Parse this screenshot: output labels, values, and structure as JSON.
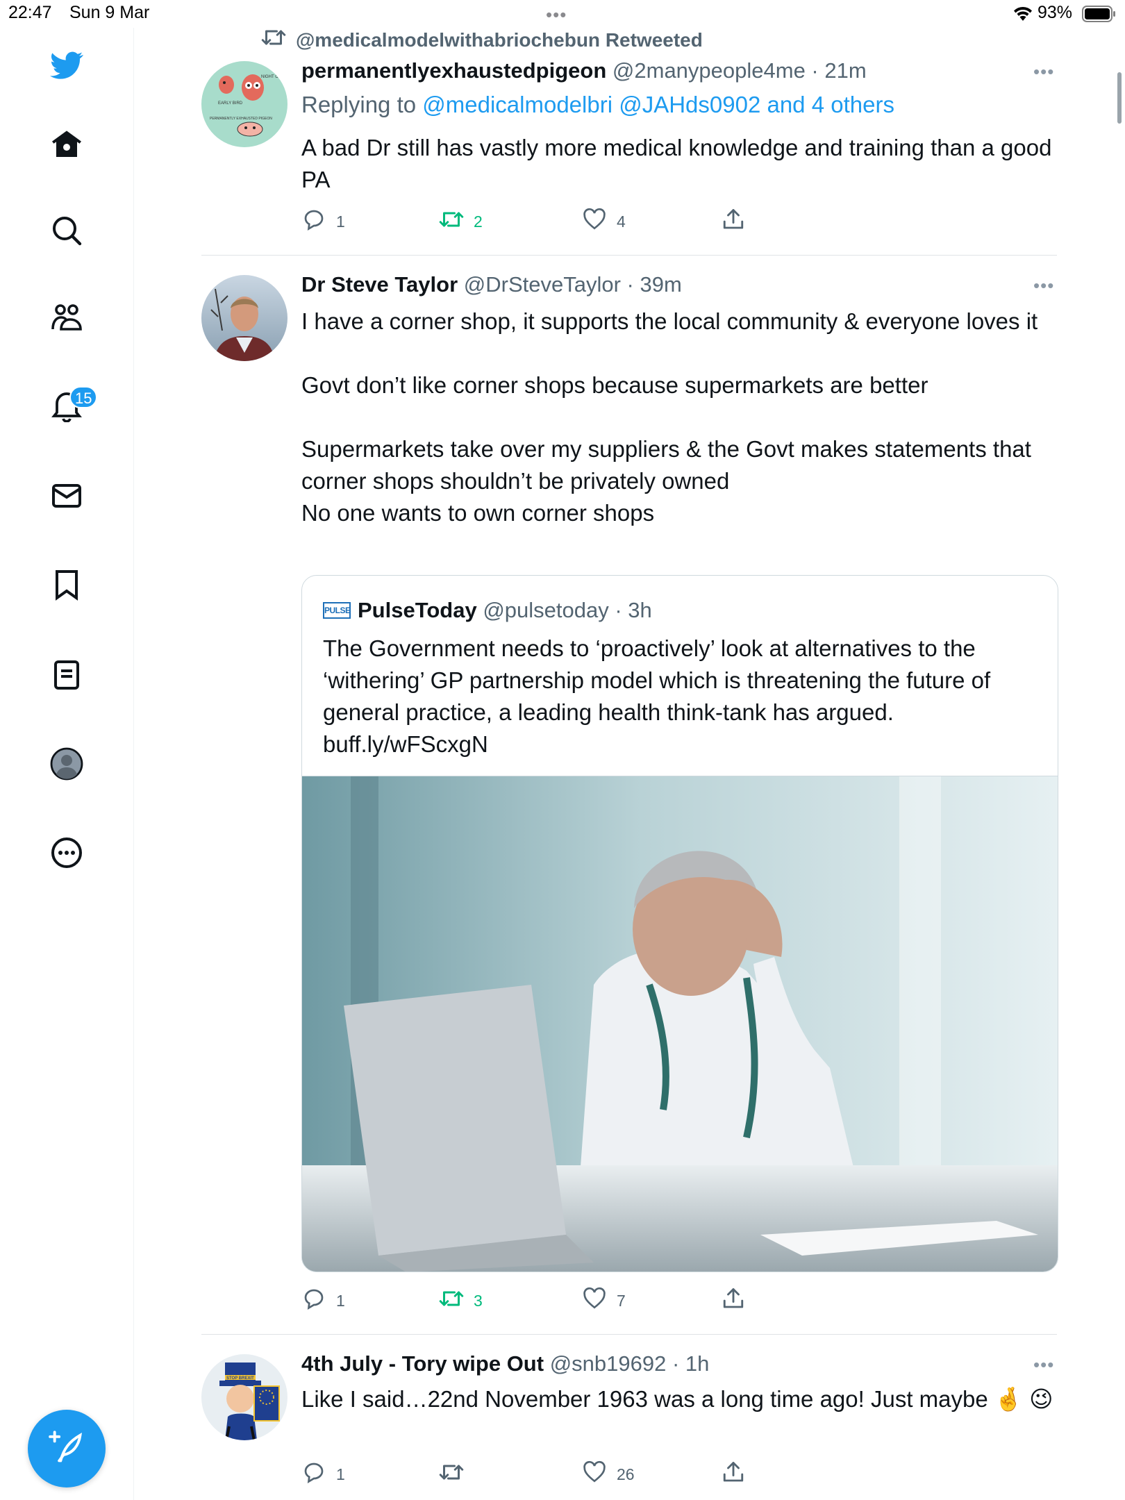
{
  "status_bar": {
    "time": "22:47",
    "date": "Sun 9 Mar",
    "battery": "93%",
    "icons": [
      "wifi-icon",
      "battery-icon"
    ]
  },
  "sidebar": {
    "items": [
      {
        "name": "twitter-logo-icon"
      },
      {
        "name": "home-icon"
      },
      {
        "name": "search-icon"
      },
      {
        "name": "communities-icon"
      },
      {
        "name": "notifications-icon",
        "badge": "15"
      },
      {
        "name": "messages-icon"
      },
      {
        "name": "bookmarks-icon"
      },
      {
        "name": "lists-icon"
      },
      {
        "name": "profile-icon"
      },
      {
        "name": "more-icon"
      }
    ],
    "compose": "compose-icon"
  },
  "colors": {
    "accent": "#1d9bf0",
    "retweet_green": "#00ba7c",
    "secondary_text": "#536471"
  },
  "retweet_context": "@medicalmodelwithabriochebun Retweeted",
  "tweets": [
    {
      "name": "permanentlyexhaustedpigeon",
      "meta": "@2manypeople4me · 21m",
      "reply_prefix": "Replying to ",
      "reply_handles": "@medicalmodelbri @JAHds0902 and 4 others",
      "text": "A bad Dr still has vastly more medical knowledge and training than a good PA",
      "replies": "1",
      "retweets": "2",
      "likes": "4",
      "avatar_text": {
        "early": "EARLY BIRD",
        "night": "NIGHT OWL",
        "caption": "PERMANENTLY EXHAUSTED PIGEON"
      }
    },
    {
      "name": "Dr Steve Taylor",
      "meta": "@DrSteveTaylor · 39m",
      "text": "I have a corner shop, it supports the local community & everyone loves it\n\nGovt don’t like corner shops because supermarkets are better\n\nSupermarkets take over my suppliers & the Govt makes statements that corner shops shouldn’t be privately owned\nNo one wants to own corner shops",
      "quote": {
        "logo": "PULSE",
        "name": "PulseToday",
        "meta": "@pulsetoday · 3h",
        "text": "The Government needs to ‘proactively’ look at alternatives to the ‘withering’ GP partnership model which is threatening the future of general practice, a leading health think-tank has argued. buff.ly/wFScxgN"
      },
      "replies": "1",
      "retweets": "3",
      "likes": "7"
    },
    {
      "name": "4th July - Tory wipe Out",
      "meta": "@snb19692 · 1h",
      "text": "Like I said…22nd November 1963 was a long time ago! Just maybe 🤞 😉",
      "replies": "1",
      "retweets": "",
      "likes": "26",
      "avatar_text": {
        "hat": "STOP BREXIT"
      }
    }
  ]
}
